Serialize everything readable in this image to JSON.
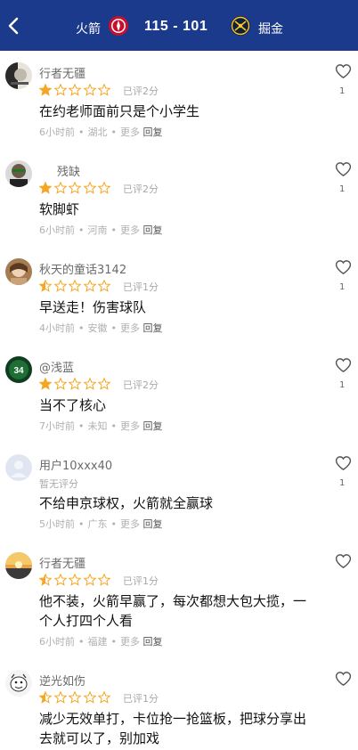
{
  "header": {
    "home_team": "火箭",
    "score": "115 - 101",
    "away_team": "掘金"
  },
  "colors": {
    "header_bg": "#1b3a8c",
    "star": "#f5a623",
    "star_empty": "#f5a623"
  },
  "comments": [
    {
      "user": "行者无疆",
      "rating": 1,
      "rated": "已评2分",
      "text": [
        "在约老师面前只是个小学生"
      ],
      "time": "6小时前",
      "location": "湖北",
      "more": "更多",
      "reply": "回复",
      "likes": "1"
    },
    {
      "user": "残缺",
      "rating": 1,
      "rated": "已评2分",
      "text": [
        "软脚虾"
      ],
      "time": "6小时前",
      "location": "河南",
      "more": "更多",
      "reply": "回复",
      "likes": "1"
    },
    {
      "user": "秋天的童话3142",
      "rating": 0.5,
      "rated": "已评1分",
      "text": [
        "早送走！伤害球队"
      ],
      "time": "4小时前",
      "location": "安徽",
      "more": "更多",
      "reply": "回复",
      "likes": "1"
    },
    {
      "user": "@浅蓝",
      "rating": 1,
      "rated": "已评2分",
      "text": [
        "当不了核心"
      ],
      "time": "7小时前",
      "location": "未知",
      "more": "更多",
      "reply": "回复",
      "likes": "1"
    },
    {
      "user": "用户10xxx40",
      "rating": null,
      "rated": "暂无评分",
      "text": [
        "不给申京球权，火箭就全赢球"
      ],
      "time": "5小时前",
      "location": "广东",
      "more": "更多",
      "reply": "回复",
      "likes": "1"
    },
    {
      "user": "行者无疆",
      "rating": 0.5,
      "rated": "已评1分",
      "text": [
        "他不装，火箭早赢了，每次都想大包大揽，一",
        "个人打四个人看"
      ],
      "time": "6小时前",
      "location": "福建",
      "more": "更多",
      "reply": "回复",
      "likes": ""
    },
    {
      "user": "逆光如伤",
      "rating": 0.5,
      "rated": "已评1分",
      "text": [
        "减少无效单打，卡位抢一抢篮板，把球分享出",
        "去就可以了，别加戏"
      ],
      "time": "",
      "location": "",
      "more": "",
      "reply": "",
      "likes": ""
    }
  ]
}
